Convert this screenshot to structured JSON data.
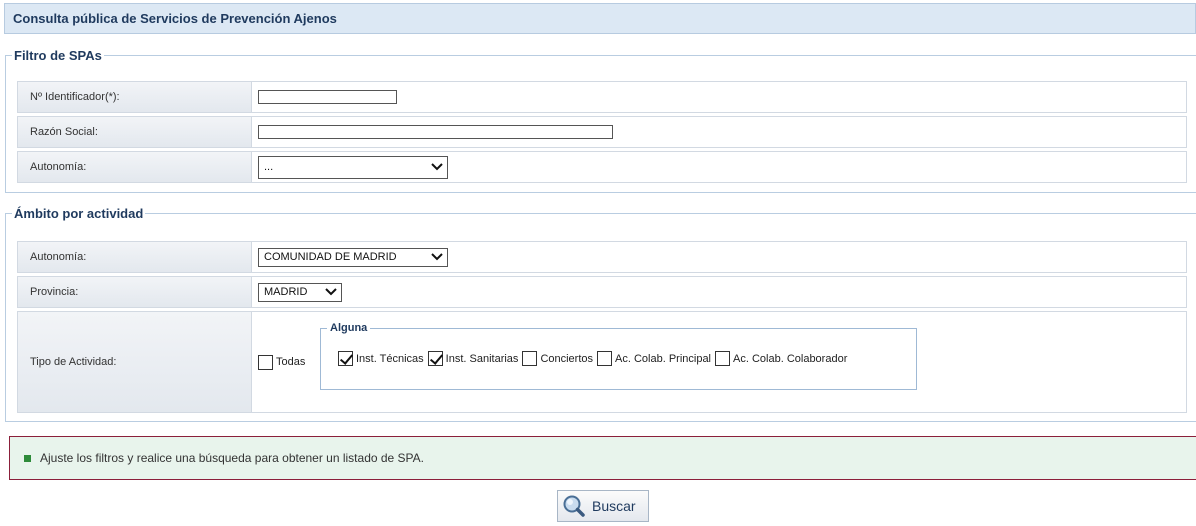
{
  "header": {
    "title": "Consulta pública de Servicios de Prevención Ajenos"
  },
  "filtro": {
    "legend": "Filtro de SPAs",
    "identificador_label": "Nº Identificador(*):",
    "identificador_value": "",
    "razon_label": "Razón Social:",
    "razon_value": "",
    "autonomia_label": "Autonomía:",
    "autonomia_selected": "..."
  },
  "ambito": {
    "legend": "Ámbito por actividad",
    "autonomia_label": "Autonomía:",
    "autonomia_selected": "COMUNIDAD DE MADRID",
    "provincia_label": "Provincia:",
    "provincia_selected": "MADRID",
    "tipo_label": "Tipo de Actividad:",
    "todas_label": "Todas",
    "todas_checked": false,
    "alguna_legend": "Alguna",
    "options": [
      {
        "label": "Inst. Técnicas",
        "checked": true
      },
      {
        "label": "Inst. Sanitarias",
        "checked": true
      },
      {
        "label": "Conciertos",
        "checked": false
      },
      {
        "label": "Ac. Colab. Principal",
        "checked": false
      },
      {
        "label": "Ac. Colab. Colaborador",
        "checked": false
      }
    ]
  },
  "message": {
    "text": "Ajuste los filtros y realice una búsqueda para obtener un listado de SPA.",
    "accent": "#2e8b3a"
  },
  "buscar": {
    "label": "Buscar",
    "icon": "search-icon"
  },
  "colors": {
    "header_bg": "#dce8f4",
    "title_text": "#1f3a5e",
    "message_border": "#8b1f3a",
    "message_bg": "#e8f4ec"
  }
}
